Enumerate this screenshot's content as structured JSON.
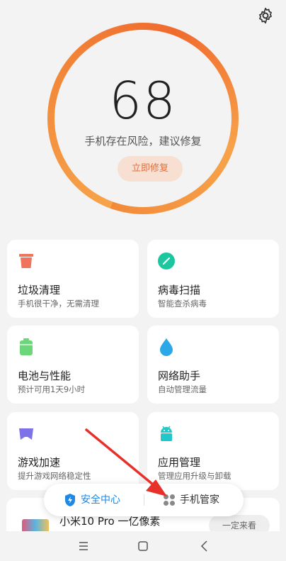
{
  "score": {
    "value": "68",
    "status": "手机存在风险，建议修复",
    "fix_button": "立即修复"
  },
  "cards": [
    {
      "title": "垃圾清理",
      "subtitle": "手机很干净，无需清理",
      "icon": "trash-icon",
      "color": "#f0745c"
    },
    {
      "title": "病毒扫描",
      "subtitle": "智能查杀病毒",
      "icon": "virus-scan-icon",
      "color": "#1cc7a0"
    },
    {
      "title": "电池与性能",
      "subtitle": "预计可用1天9小时",
      "icon": "battery-icon",
      "color": "#6cd67b"
    },
    {
      "title": "网络助手",
      "subtitle": "自动管理流量",
      "icon": "water-drop-icon",
      "color": "#2aa8e8"
    },
    {
      "title": "游戏加速",
      "subtitle": "提升游戏网络稳定性",
      "icon": "gamepad-icon",
      "color": "#7e72e8"
    },
    {
      "title": "应用管理",
      "subtitle": "管理应用升级与卸载",
      "icon": "android-icon",
      "color": "#22c7c9"
    }
  ],
  "banner": {
    "text": "小米10 Pro 一亿像素",
    "button": "一定来看"
  },
  "float_bar": {
    "security_center": "安全中心",
    "phone_manager": "手机管家"
  },
  "colors": {
    "ring": "#f28a3a",
    "security_blue": "#1e88e5",
    "arrow_red": "#e8302a"
  }
}
